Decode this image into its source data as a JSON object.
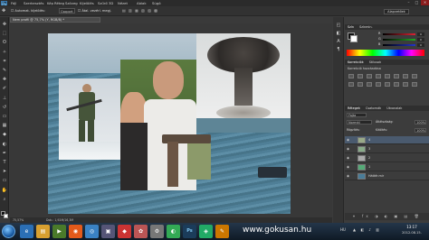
{
  "menu": [
    "Fájl",
    "Szerkesztés",
    "Kép",
    "Réteg",
    "Szöveg",
    "Kijelölés",
    "Szűrő",
    "3D",
    "Nézet",
    "Ablak",
    "Súgó"
  ],
  "options": {
    "preset": "Automat. kijelölés:",
    "mode": "Csoport",
    "transform": "Átal. vezérl. megj."
  },
  "workspace": "Alapvetőek",
  "document_tab": "Nem profil @ 75,7% (Y, RGB/8) *",
  "status": {
    "zoom": "75,57%",
    "doc_size": "Dok.: 1,92M/16,3M"
  },
  "color_panel": {
    "tabs": [
      "Szín",
      "Színmin."
    ],
    "sliders": [
      {
        "label": "R",
        "value": "0",
        "color": "#d23"
      },
      {
        "label": "G",
        "value": "0",
        "color": "#2a2"
      },
      {
        "label": "B",
        "value": "0",
        "color": "#23c"
      }
    ]
  },
  "adjust_panel": {
    "tabs": [
      "Korrekciók",
      "Stílusok"
    ],
    "title": "Korrekció hozzáadása"
  },
  "layers_panel": {
    "tabs": [
      "Rétegek",
      "Csatornák",
      "Útvonalak"
    ],
    "kind": "Fajta",
    "blend": "Normál",
    "opacity_label": "Átlátszóság:",
    "opacity": "100%",
    "lock_label": "Rögzítés:",
    "fill_label": "Kitöltés:",
    "fill": "100%",
    "layers": [
      {
        "name": "4",
        "thumb": "#9a8"
      },
      {
        "name": "3",
        "thumb": "#8a8"
      },
      {
        "name": "2",
        "thumb": "#aaa"
      },
      {
        "name": "1",
        "thumb": "#5a7"
      },
      {
        "name": "Háttér.mir",
        "thumb": "#4a7d99"
      }
    ]
  },
  "watermark": "www.gokusan.hu",
  "tray": {
    "lang": "HU",
    "time": "13:17",
    "date": "2012.08.15."
  },
  "colors": {
    "accent": "#1c5fa8",
    "panel": "#3c3c3c"
  }
}
